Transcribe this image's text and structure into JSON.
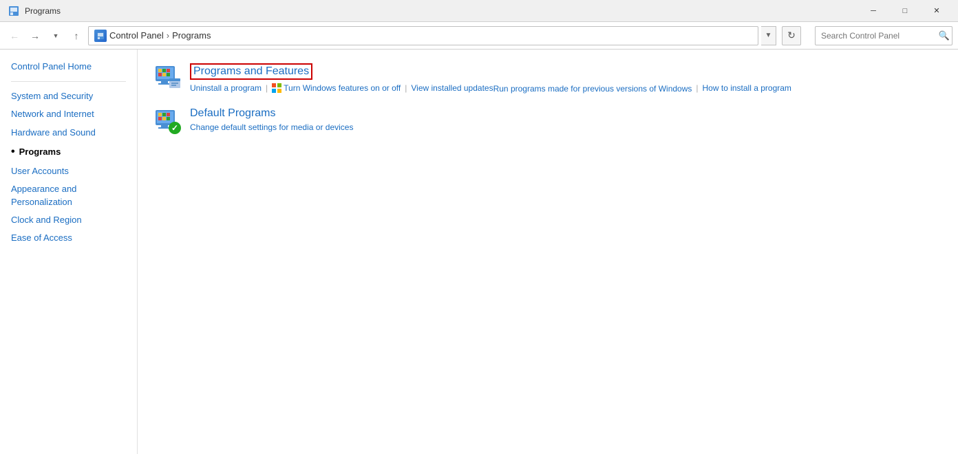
{
  "window": {
    "title": "Programs",
    "icon": "control-panel-icon"
  },
  "titlebar": {
    "minimize_label": "─",
    "maximize_label": "□",
    "close_label": "✕"
  },
  "addressbar": {
    "back_tooltip": "Back",
    "forward_tooltip": "Forward",
    "dropdown_tooltip": "Recent locations",
    "up_tooltip": "Up",
    "breadcrumb": {
      "icon": "control-panel-icon",
      "parts": [
        "Control Panel",
        "Programs"
      ]
    },
    "refresh_symbol": "↻",
    "search_placeholder": "Search Control Panel",
    "search_icon": "🔍"
  },
  "sidebar": {
    "items": [
      {
        "id": "control-panel-home",
        "label": "Control Panel Home",
        "active": false
      },
      {
        "id": "system-and-security",
        "label": "System and Security",
        "active": false
      },
      {
        "id": "network-and-internet",
        "label": "Network and Internet",
        "active": false
      },
      {
        "id": "hardware-and-sound",
        "label": "Hardware and Sound",
        "active": false
      },
      {
        "id": "programs",
        "label": "Programs",
        "active": true
      },
      {
        "id": "user-accounts",
        "label": "User Accounts",
        "active": false
      },
      {
        "id": "appearance-and-personalization",
        "label": "Appearance and Personalization",
        "active": false
      },
      {
        "id": "clock-and-region",
        "label": "Clock and Region",
        "active": false
      },
      {
        "id": "ease-of-access",
        "label": "Ease of Access",
        "active": false
      }
    ]
  },
  "content": {
    "categories": [
      {
        "id": "programs-and-features",
        "title": "Programs and Features",
        "title_has_border": true,
        "links": [
          {
            "id": "uninstall-program",
            "label": "Uninstall a program"
          },
          {
            "id": "turn-windows-features",
            "label": "Turn Windows features on or off",
            "has_icon": true
          },
          {
            "id": "view-installed-updates",
            "label": "View installed updates"
          },
          {
            "id": "run-programs-previous",
            "label": "Run programs made for previous versions of Windows"
          },
          {
            "id": "how-to-install",
            "label": "How to install a program"
          }
        ]
      },
      {
        "id": "default-programs",
        "title": "Default Programs",
        "title_has_border": false,
        "links": [
          {
            "id": "change-default-settings",
            "label": "Change default settings for media or devices"
          }
        ]
      }
    ]
  }
}
